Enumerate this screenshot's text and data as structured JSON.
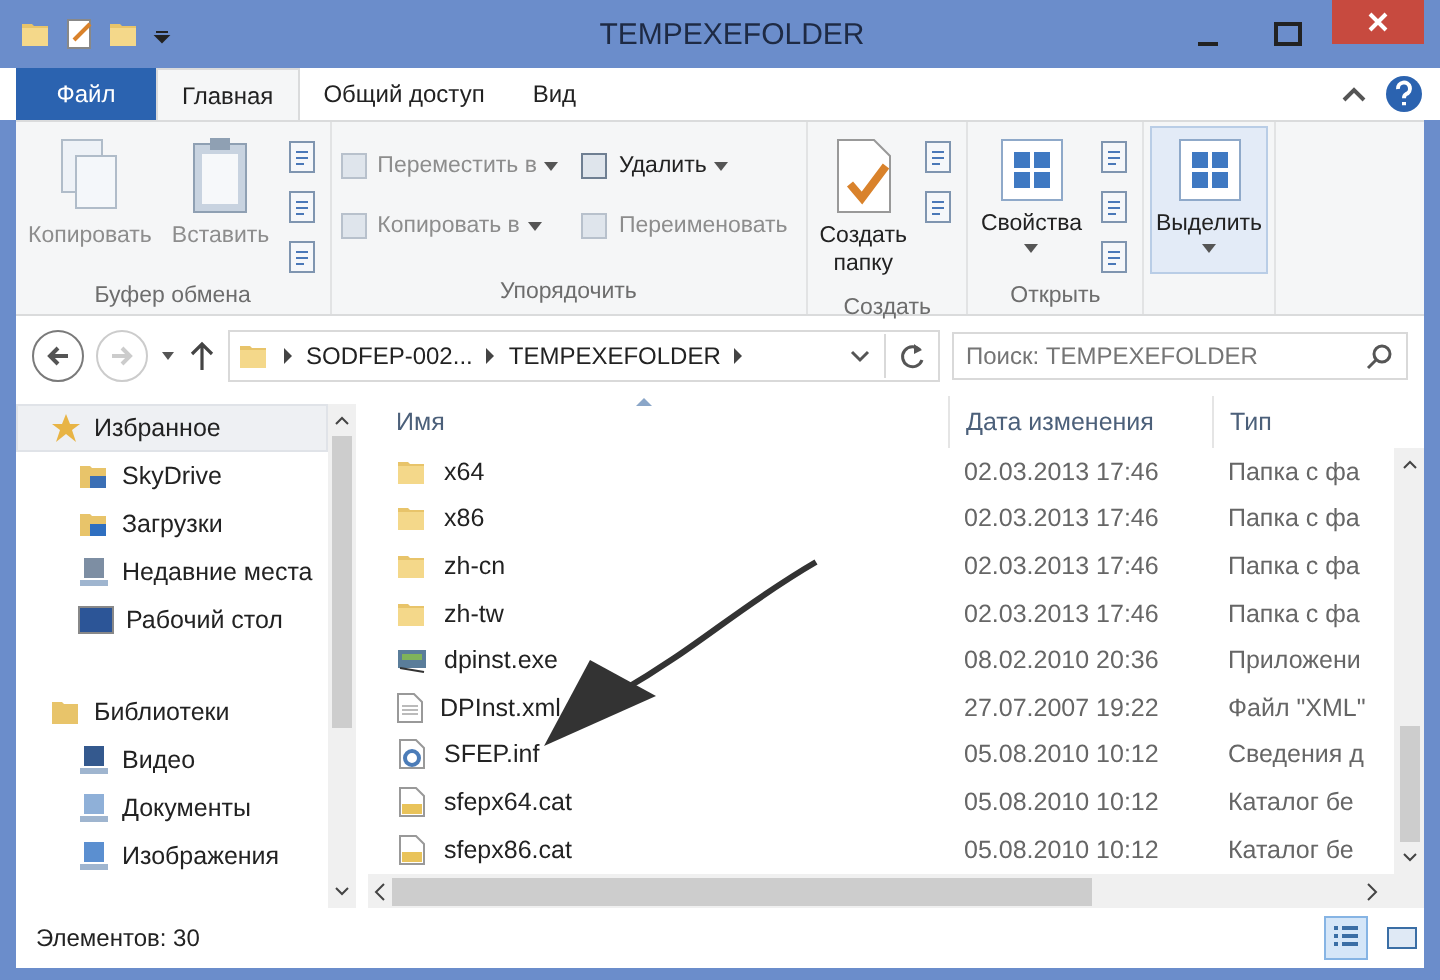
{
  "window": {
    "title": "TEMPEXEFOLDER"
  },
  "ribbon_tabs": [
    {
      "label": "Файл",
      "kind": "file",
      "selected": false
    },
    {
      "label": "Главная",
      "kind": "tab",
      "selected": true
    },
    {
      "label": "Общий доступ",
      "kind": "tab",
      "selected": false
    },
    {
      "label": "Вид",
      "kind": "tab",
      "selected": false
    }
  ],
  "ribbon_groups": [
    {
      "label": "Буфер обмена",
      "items": [
        {
          "label": "Копировать",
          "kind": "large",
          "disabled": true,
          "dropdown": false,
          "pressed": false
        },
        {
          "label": "Вставить",
          "kind": "large",
          "disabled": true,
          "dropdown": false,
          "pressed": false
        },
        {
          "kind": "iconstack"
        }
      ]
    },
    {
      "label": "Упорядочить",
      "items": [
        {
          "kind": "smallstack",
          "rows": [
            {
              "label": "Переместить в",
              "disabled": true,
              "dropdown": true
            },
            {
              "label": "Копировать в",
              "disabled": true,
              "dropdown": true
            }
          ]
        },
        {
          "kind": "smallstack",
          "rows": [
            {
              "label": "Удалить",
              "disabled": false,
              "dropdown": true
            },
            {
              "label": "Переименовать",
              "disabled": true,
              "dropdown": false
            }
          ]
        }
      ]
    },
    {
      "label": "Создать",
      "items": [
        {
          "label": "Создать папку",
          "kind": "large",
          "disabled": false,
          "dropdown": false,
          "pressed": false
        },
        {
          "kind": "iconstack"
        }
      ]
    },
    {
      "label": "Открыть",
      "items": [
        {
          "label": "Свойства",
          "kind": "large",
          "disabled": false,
          "dropdown": true,
          "pressed": false
        },
        {
          "kind": "iconstack"
        }
      ]
    },
    {
      "items": [
        {
          "label": "Выделить",
          "kind": "large",
          "disabled": false,
          "dropdown": true,
          "pressed": true
        }
      ]
    }
  ],
  "address": {
    "crumbs": [
      "SODFEP-002...",
      "TEMPEXEFOLDER"
    ]
  },
  "search": {
    "placeholder": "Поиск: TEMPEXEFOLDER"
  },
  "sidebar": {
    "items": [
      {
        "label": "Избранное",
        "kind": "favorites",
        "selected": true,
        "children": [
          {
            "label": "SkyDrive",
            "kind": "cloud",
            "selected": false
          },
          {
            "label": "Загрузки",
            "kind": "download",
            "selected": false
          },
          {
            "label": "Недавние места",
            "kind": "recent",
            "selected": false
          },
          {
            "label": "Рабочий стол",
            "kind": "desktop",
            "selected": false
          }
        ]
      },
      {
        "label": "Библиотеки",
        "kind": "library",
        "selected": false,
        "children": [
          {
            "label": "Видео",
            "kind": "video",
            "selected": false
          },
          {
            "label": "Документы",
            "kind": "docs",
            "selected": false
          },
          {
            "label": "Изображения",
            "kind": "images",
            "selected": false
          }
        ]
      }
    ]
  },
  "table": {
    "columns": [
      "Имя",
      "Дата изменения",
      "Тип"
    ],
    "rows": [
      {
        "name": "x64",
        "kind": "folder",
        "date": "02.03.2013 17:46",
        "type": "Папка с фа"
      },
      {
        "name": "x86",
        "kind": "folder",
        "date": "02.03.2013 17:46",
        "type": "Папка с фа"
      },
      {
        "name": "zh-cn",
        "kind": "folder",
        "date": "02.03.2013 17:46",
        "type": "Папка с фа"
      },
      {
        "name": "zh-tw",
        "kind": "folder",
        "date": "02.03.2013 17:46",
        "type": "Папка с фа"
      },
      {
        "name": "dpinst.exe",
        "kind": "exe",
        "date": "08.02.2010 20:36",
        "type": "Приложени"
      },
      {
        "name": "DPInst.xml",
        "kind": "xml",
        "date": "27.07.2007 19:22",
        "type": "Файл \"XML\""
      },
      {
        "name": "SFEP.inf",
        "kind": "inf",
        "date": "05.08.2010 10:12",
        "type": "Сведения д"
      },
      {
        "name": "sfepx64.cat",
        "kind": "cat",
        "date": "05.08.2010 10:12",
        "type": "Каталог бе"
      },
      {
        "name": "sfepx86.cat",
        "kind": "cat",
        "date": "05.08.2010 10:12",
        "type": "Каталог бе"
      }
    ]
  },
  "status_bar": {
    "text": "Элементов: 30",
    "views": [
      {
        "kind": "details",
        "selected": true
      },
      {
        "kind": "tiles",
        "selected": false
      }
    ]
  }
}
